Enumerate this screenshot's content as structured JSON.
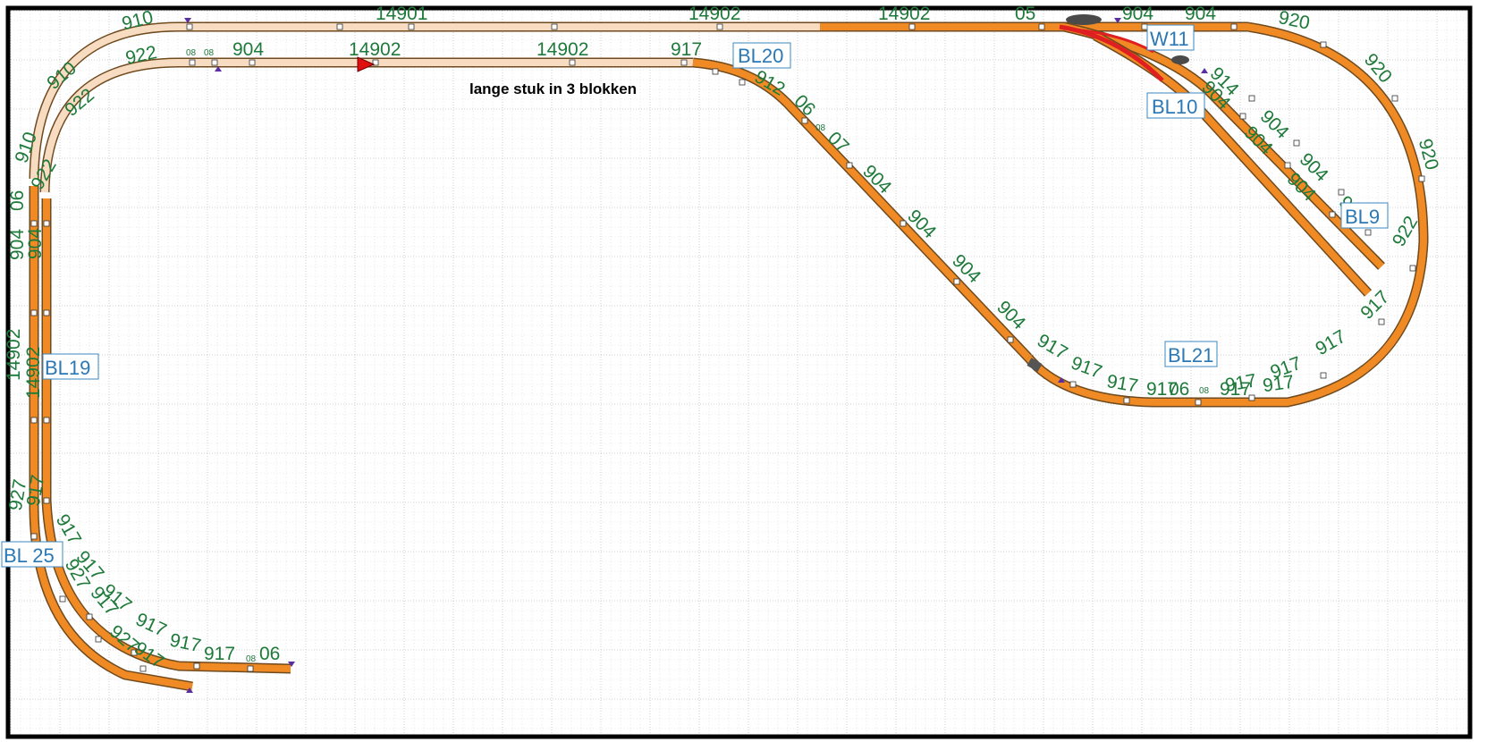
{
  "layout": {
    "note": "lange stuk in 3 blokken",
    "colors": {
      "track": "#f08a24",
      "track_light": "#f7dcc2",
      "track_edge": "#6e4a1e",
      "switch_red": "#e02020",
      "label_green": "#1e7a3a",
      "block_blue": "#2b78b4",
      "signal_red": "#e01010",
      "frame": "#000000"
    },
    "blocks": [
      {
        "id": "BL20",
        "label": "BL20"
      },
      {
        "id": "BL10",
        "label": "BL10"
      },
      {
        "id": "W11",
        "label": "W11"
      },
      {
        "id": "BL9",
        "label": "BL9"
      },
      {
        "id": "BL21",
        "label": "BL21"
      },
      {
        "id": "BL19",
        "label": "BL19"
      },
      {
        "id": "BL25",
        "label": "BL 25"
      }
    ],
    "part_labels": {
      "top": [
        "910",
        "14901",
        "14902",
        "14902",
        "05",
        "904",
        "904",
        "920",
        "922",
        "08",
        "08",
        "904",
        "14902",
        "14902",
        "917",
        "912"
      ],
      "right": [
        "920",
        "920",
        "914",
        "904",
        "904",
        "904",
        "904",
        "904",
        "904",
        "922",
        "917",
        "917",
        "917",
        "917"
      ],
      "middle": [
        "06",
        "08",
        "07",
        "904",
        "904",
        "904",
        "904",
        "917",
        "917",
        "917",
        "917",
        "06",
        "08",
        "917",
        "917"
      ],
      "left": [
        "910",
        "922",
        "910",
        "922",
        "904",
        "06",
        "904",
        "14902",
        "14902",
        "927",
        "917",
        "917",
        "917",
        "917",
        "917",
        "917",
        "917",
        "917",
        "917",
        "08",
        "06",
        "927",
        "927"
      ]
    }
  }
}
